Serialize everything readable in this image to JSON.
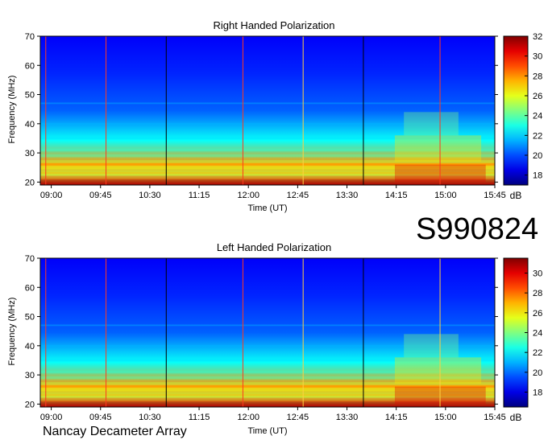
{
  "dataset_id": "S990824",
  "observatory": "Nancay Decameter Array",
  "colorbar_unit": "dB",
  "colors": {
    "low": "#00008f",
    "mid": "#2aa8ff",
    "high": "#8b0000",
    "marker_red": "#ff3b1f",
    "marker_yellow": "#ffd040",
    "marker_black": "#000000"
  },
  "chart_data": [
    {
      "type": "heatmap",
      "title": "Right Handed Polarization",
      "xlabel": "Time (UT)",
      "ylabel": "Frequency (MHz)",
      "xticks": [
        "09:00",
        "09:45",
        "10:30",
        "11:15",
        "12:00",
        "12:45",
        "13:30",
        "14:15",
        "15:00",
        "15:45"
      ],
      "xlim": [
        "08:50",
        "15:45"
      ],
      "ylim": [
        19,
        70
      ],
      "yticks": [
        20,
        30,
        40,
        50,
        60,
        70
      ],
      "colorbar": {
        "min": 17,
        "max": 32,
        "ticks": [
          18,
          20,
          22,
          24,
          26,
          28,
          30,
          32
        ],
        "unit": "dB"
      },
      "time_markers": [
        {
          "time": "08:55",
          "color": "red"
        },
        {
          "time": "09:50",
          "color": "red"
        },
        {
          "time": "10:45",
          "color": "black"
        },
        {
          "time": "11:55",
          "color": "red"
        },
        {
          "time": "12:50",
          "color": "yellow"
        },
        {
          "time": "13:45",
          "color": "black"
        },
        {
          "time": "14:55",
          "color": "red"
        }
      ]
    },
    {
      "type": "heatmap",
      "title": "Left Handed Polarization",
      "xlabel": "Time (UT)",
      "ylabel": "Frequency (MHz)",
      "xticks": [
        "09:00",
        "09:45",
        "10:30",
        "11:15",
        "12:00",
        "12:45",
        "13:30",
        "14:15",
        "15:00",
        "15:45"
      ],
      "xlim": [
        "08:50",
        "15:45"
      ],
      "ylim": [
        19,
        70
      ],
      "yticks": [
        20,
        30,
        40,
        50,
        60,
        70
      ],
      "colorbar": {
        "min": 16.5,
        "max": 31.5,
        "ticks": [
          18,
          20,
          22,
          24,
          26,
          28,
          30
        ],
        "unit": "dB"
      },
      "time_markers": [
        {
          "time": "08:55",
          "color": "red"
        },
        {
          "time": "09:50",
          "color": "red"
        },
        {
          "time": "10:45",
          "color": "black"
        },
        {
          "time": "11:55",
          "color": "red"
        },
        {
          "time": "12:50",
          "color": "yellow"
        },
        {
          "time": "13:45",
          "color": "black"
        },
        {
          "time": "14:55",
          "color": "yellow"
        }
      ]
    }
  ]
}
